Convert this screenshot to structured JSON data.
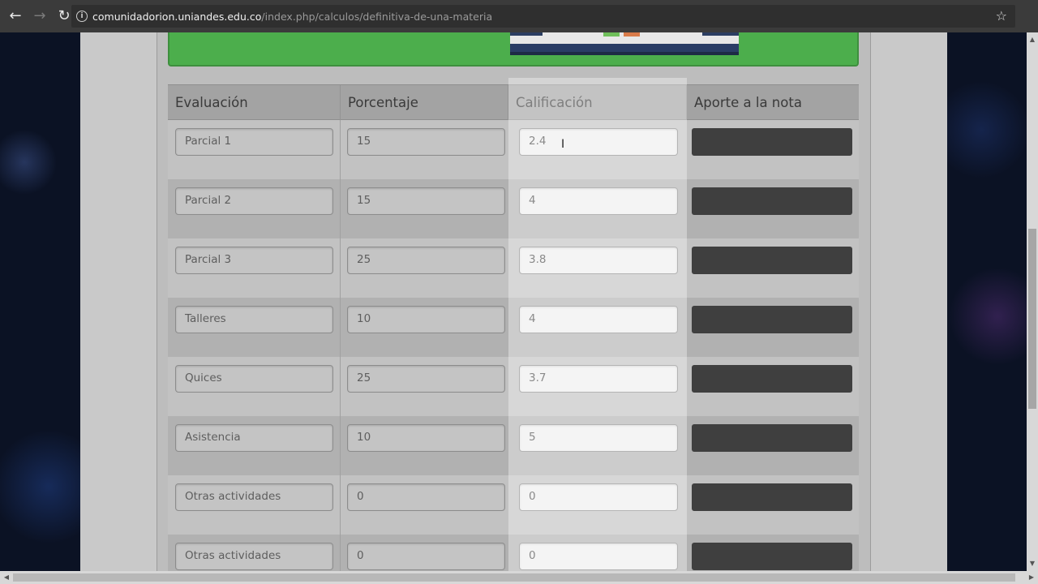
{
  "browser": {
    "url_host": "comunidadorion.uniandes.edu.co",
    "url_path": "/index.php/calculos/definitiva-de-una-materia",
    "back_icon": "back-arrow-icon",
    "forward_icon": "forward-arrow-icon",
    "reload_icon": "reload-icon",
    "bookmark_icon": "star-icon"
  },
  "colors": {
    "accent_green": "#4cae4c",
    "aporte_dark": "#3f3f3f",
    "header_gray": "#a3a3a3"
  },
  "table": {
    "headers": {
      "evaluacion": "Evaluación",
      "porcentaje": "Porcentaje",
      "calificacion": "Calificación",
      "aporte": "Aporte a la nota"
    },
    "rows": [
      {
        "evaluacion": "Parcial 1",
        "porcentaje": "15",
        "calificacion": "2.4"
      },
      {
        "evaluacion": "Parcial 2",
        "porcentaje": "15",
        "calificacion": "4"
      },
      {
        "evaluacion": "Parcial 3",
        "porcentaje": "25",
        "calificacion": "3.8"
      },
      {
        "evaluacion": "Talleres",
        "porcentaje": "10",
        "calificacion": "4"
      },
      {
        "evaluacion": "Quices",
        "porcentaje": "25",
        "calificacion": "3.7"
      },
      {
        "evaluacion": "Asistencia",
        "porcentaje": "10",
        "calificacion": "5"
      },
      {
        "evaluacion": "Otras actividades",
        "porcentaje": "0",
        "calificacion": "0"
      },
      {
        "evaluacion": "Otras actividades",
        "porcentaje": "0",
        "calificacion": "0"
      }
    ]
  }
}
